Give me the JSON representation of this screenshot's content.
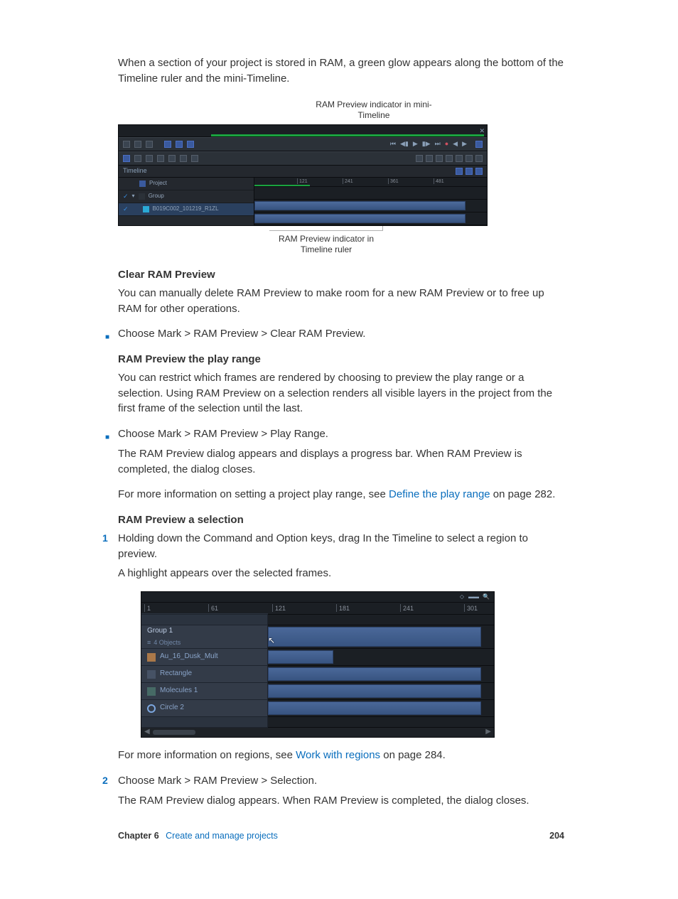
{
  "intro": "When a section of your project is stored in RAM, a green glow appears along the bottom of the Timeline ruler and the mini-Timeline.",
  "fig1": {
    "annot_top": "RAM Preview indicator in mini-Timeline",
    "timeline_label": "Timeline",
    "rows": {
      "project": "Project",
      "group": "Group",
      "clip": "B019C002_101219_R1ZL"
    },
    "ticks": [
      "121",
      "241",
      "361",
      "481"
    ],
    "annot_bottom": "RAM Preview indicator in Timeline ruler"
  },
  "clear": {
    "heading": "Clear RAM Preview",
    "body": "You can manually delete RAM Preview to make room for a new RAM Preview or to free up RAM for other operations.",
    "bullet": "Choose Mark > RAM Preview > Clear RAM Preview."
  },
  "playrange": {
    "heading": "RAM Preview the play range",
    "body": "You can restrict which frames are rendered by choosing to preview the play range or a selection. Using RAM Preview on a selection renders all visible layers in the project from the first frame of the selection until the last.",
    "bullet": "Choose Mark > RAM Preview > Play Range.",
    "after1": "The RAM Preview dialog appears and displays a progress bar. When RAM Preview is completed, the dialog closes.",
    "after2a": "For more information on setting a project play range, see ",
    "link": "Define the play range",
    "after2b": " on page 282."
  },
  "selection": {
    "heading": "RAM Preview a selection",
    "step1": "Holding down the Command and Option keys, drag In the Timeline to select a region to preview.",
    "step1_after": "A highlight appears over the selected frames.",
    "fig2": {
      "ticks": [
        "1",
        "61",
        "121",
        "181",
        "241",
        "301"
      ],
      "rows": [
        {
          "label": "Group 1",
          "sub": "4 Objects"
        },
        {
          "label": "Au_16_Dusk_Mult"
        },
        {
          "label": "Rectangle"
        },
        {
          "label": "Molecules 1"
        },
        {
          "label": "Circle 2"
        }
      ]
    },
    "after_img_a": "For more information on regions, see ",
    "after_img_link": "Work with regions",
    "after_img_b": " on page 284.",
    "step2": "Choose Mark > RAM Preview > Selection.",
    "step2_after": "The RAM Preview dialog appears. When RAM Preview is completed, the dialog closes."
  },
  "footer": {
    "chapter": "Chapter 6",
    "title": "Create and manage projects",
    "page": "204"
  }
}
